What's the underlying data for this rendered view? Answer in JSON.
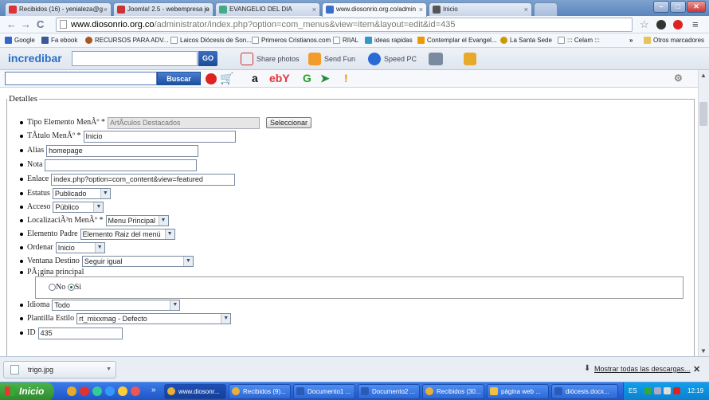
{
  "tabs": [
    {
      "label": "Recibidos (16) - yenialeza@g",
      "active": false
    },
    {
      "label": "Joomla! 2.5 - webempresa jo",
      "active": false
    },
    {
      "label": "EVANGELIO DEL DIA",
      "active": false
    },
    {
      "label": "www.diosonrio.org.co/admin",
      "active": true
    },
    {
      "label": "Inicio",
      "active": false
    }
  ],
  "window_controls": {
    "minimize": "–",
    "maximize": "□",
    "close": "✕"
  },
  "address": {
    "host": "www.diosonrio.org.co",
    "path": "/administrator/index.php?option=com_menus&view=item&layout=edit&id=435"
  },
  "bookmarks": [
    "Google",
    "Fa  ebook",
    "RECURSOS PARA ADV...",
    "Laicos Diócesis de Son...",
    "Primeros Cristianos.com",
    "RIIAL",
    "ideas rapidas",
    "Contemplar el Evangel...",
    "La Santa Sede",
    "::: Celam :::"
  ],
  "bookmarks_more": "»",
  "other_bookmarks": "Otros marcadores",
  "incredibar": {
    "logo": "incredibar",
    "go": "GO",
    "buttons": [
      "Share photos",
      "Send Fun",
      "Speed PC"
    ]
  },
  "searchbar": {
    "button": "Buscar",
    "icons": [
      "a",
      "ebY",
      "G"
    ]
  },
  "form": {
    "legend": "Detalles",
    "fields": {
      "tipo_label": "Tipo Elemento MenÃº *",
      "tipo_value": "ArtÃ­culos Destacados",
      "tipo_button": "Seleccionar",
      "titulo_label": "TÃ­tulo MenÃº *",
      "titulo_value": "Inicio",
      "alias_label": "Alias",
      "alias_value": "homepage",
      "nota_label": "Nota",
      "nota_value": "",
      "enlace_label": "Enlace",
      "enlace_value": "index.php?option=com_content&view=featured",
      "estatus_label": "Estatus",
      "estatus_value": "Publicado",
      "acceso_label": "Acceso",
      "acceso_value": "Público",
      "localizacion_label": "LocalizaciÃ³n MenÃº *",
      "localizacion_value": "Menu Principal",
      "padre_label": "Elemento Padre",
      "padre_value": "Elemento Raiz del menú",
      "ordenar_label": "Ordenar",
      "ordenar_value": "Inicio",
      "ventana_label": "Ventana Destino",
      "ventana_value": "Seguir igual",
      "pagina_label": "PÃ¡gina principal",
      "pagina_no": "No",
      "pagina_si": "Si",
      "idioma_label": "Idioma",
      "idioma_value": "Todo",
      "plantilla_label": "Plantilla Estilo",
      "plantilla_value": "rt_mixxmag - Defecto",
      "id_label": "ID",
      "id_value": "435"
    }
  },
  "downloads": {
    "file": "trigo.jpg",
    "show_all": "Mostrar todas las descargas...",
    "close": "✕"
  },
  "taskbar": {
    "start": "Inicio",
    "tasks": [
      "www.diosonr...",
      "Recibidos (9)...",
      "Documento1 ...",
      "Documento2 ...",
      "Recibidos (30...",
      "página web ...",
      "diócesis.docx..."
    ],
    "lang": "ES",
    "time": "12:19"
  }
}
